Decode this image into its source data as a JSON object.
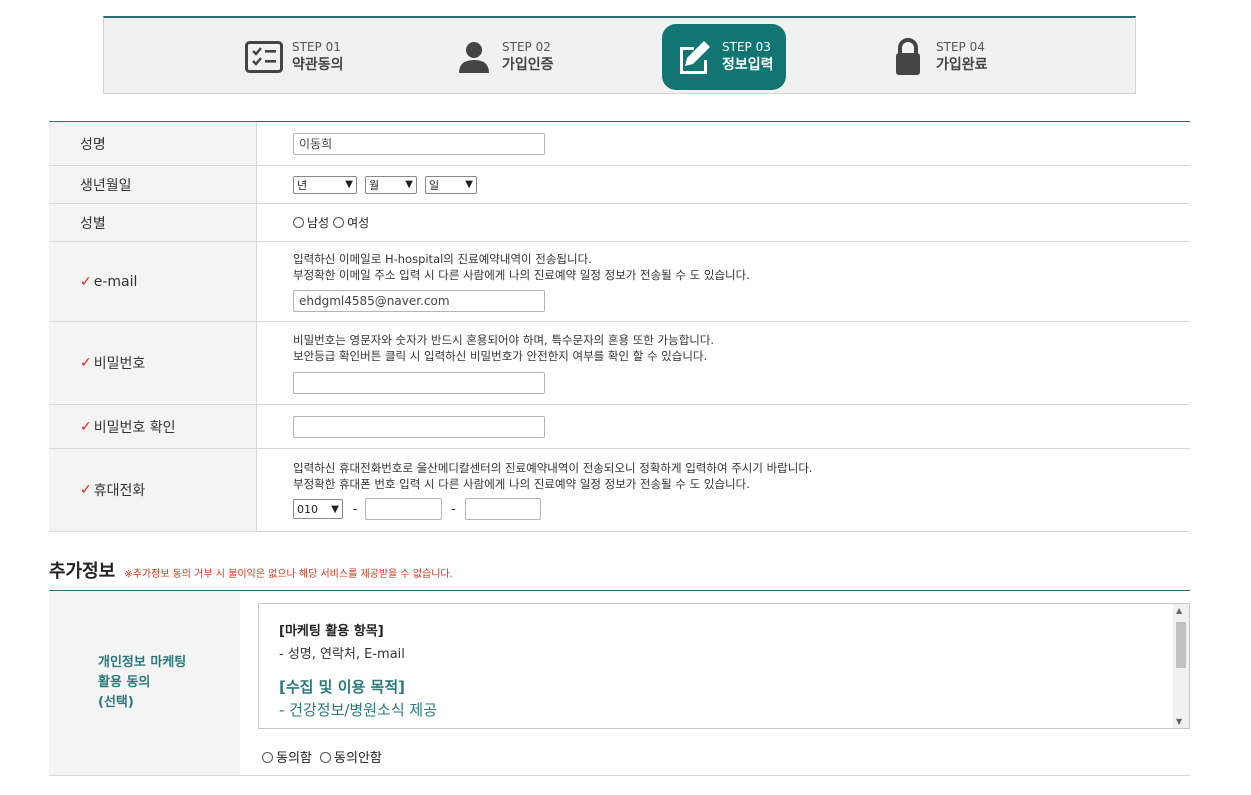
{
  "steps": [
    {
      "num": "STEP 01",
      "name": "약관동의",
      "icon": "checklist-icon"
    },
    {
      "num": "STEP 02",
      "name": "가입인증",
      "icon": "user-icon"
    },
    {
      "num": "STEP 03",
      "name": "정보입력",
      "icon": "edit-icon",
      "active": true
    },
    {
      "num": "STEP 04",
      "name": "가입완료",
      "icon": "lock-icon"
    }
  ],
  "form": {
    "name": {
      "label": "성명",
      "value": "이동희"
    },
    "birth": {
      "label": "생년월일",
      "year": "년",
      "month": "월",
      "day": "일"
    },
    "gender": {
      "label": "성별",
      "male": "남성",
      "female": "여성"
    },
    "email": {
      "label": "e-mail",
      "note1": "입력하신 이메일로 H-hospital의 진료예약내역이 전송됩니다.",
      "note2": "부정확한 이메일 주소 입력 시 다른 사람에게 나의 진료예약 일정 정보가 전송될 수 도 있습니다.",
      "value": "ehdgml4585@naver.com"
    },
    "password": {
      "label": "비밀번호",
      "note1": "비밀번호는 영문자와 숫자가 반드시 혼용되어야 하며, 특수문자의 혼용 또한 가능합니다.",
      "note2": "보안등급 확인버튼 클릭 시 입력하신 비밀번호가 안전한지 여부를 확인 할 수 있습니다.",
      "value": ""
    },
    "password_confirm": {
      "label": "비밀번호 확인",
      "value": ""
    },
    "phone": {
      "label": "휴대전화",
      "note1": "입력하신 휴대전화번호로 울산메디칼센터의 진료예약내역이 전송되오니 정확하게 입력하여 주시기 바랍니다.",
      "note2": "부정확한 휴대폰 번호 입력 시 다른 사람에게 나의 진료예약 일정 정보가 전송될 수 도 있습니다.",
      "prefix": "010",
      "dash": "-"
    }
  },
  "check_mark": "✓",
  "extra": {
    "title": "추가정보",
    "warning": "※추가정보 동의 거부 시 불이익은 없으나 해당 서비스를 제공받을 수 없습니다."
  },
  "marketing": {
    "label_line1": "개인정보 마케팅",
    "label_line2": "활용 동의",
    "label_line3": "(선택)",
    "section1_title": "[마케팅 활용 항목]",
    "section1_text": "- 성명, 연락처, E-mail",
    "section2_title": "[수집 및 이용 목적]",
    "section2_text": "- 건강정보/병원소식 제공",
    "agree": "동의함",
    "disagree": "동의안함"
  },
  "colors": {
    "accent": "#137474",
    "required": "#e02020",
    "warning": "#d0381f"
  }
}
